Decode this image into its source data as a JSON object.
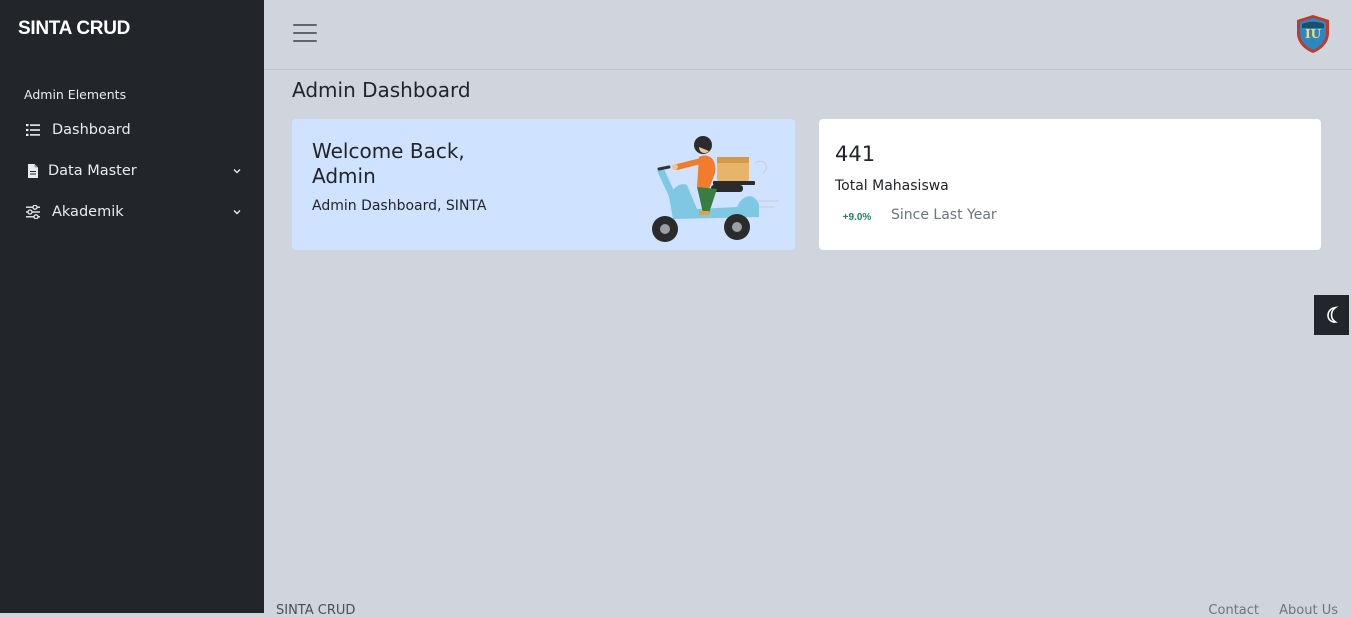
{
  "app": {
    "brand": "SINTA CRUD"
  },
  "sidebar": {
    "header": "Admin Elements",
    "items": [
      {
        "label": "Dashboard",
        "icon": "list-icon"
      },
      {
        "label": "Data Master",
        "icon": "file-icon"
      },
      {
        "label": "Akademik",
        "icon": "sliders-icon"
      }
    ]
  },
  "main": {
    "page_title": "Admin Dashboard",
    "welcome": {
      "title": "Welcome Back, Admin",
      "subtitle": "Admin Dashboard, SINTA",
      "color": "#cfe2ff"
    },
    "stat": {
      "value": "441",
      "label": "Total Mahasiswa",
      "change": "+9.0%",
      "change_color": "#198754",
      "since": "Since Last Year"
    }
  },
  "footer": {
    "brand": "SINTA CRUD",
    "links": [
      "Contact",
      "About Us"
    ]
  },
  "colors": {
    "sidebar_bg": "#222529",
    "page_bg": "#d0d4dc",
    "card_bg": "#ffffff"
  }
}
